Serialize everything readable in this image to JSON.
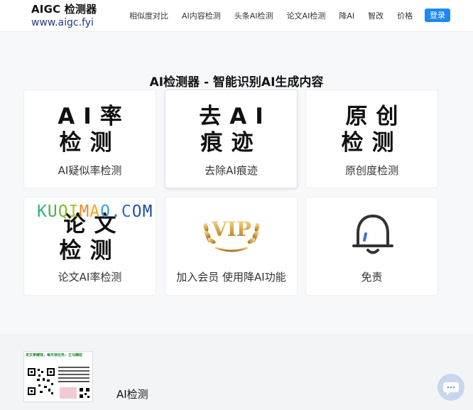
{
  "brand": {
    "title": "AIGC 检测器",
    "url": "www.aigc.fyi"
  },
  "nav": [
    "相似度对比",
    "AI内容检测",
    "头条AI检测",
    "论文AI检测",
    "降AI",
    "智改",
    "价格"
  ],
  "login_label": "登录",
  "page_title": "AI检测器 - 智能识别AI生成内容",
  "cards": [
    {
      "big": "AI率\n检测",
      "caption": "AI疑似率检测"
    },
    {
      "big": "去AI\n痕迹",
      "caption": "去除AI痕迹"
    },
    {
      "big": "原创\n检测",
      "caption": "原创度检测"
    },
    {
      "big": "论文\n检测",
      "caption": "论文AI率检测"
    },
    {
      "icon": "vip-badge-icon",
      "icon_text": "VIP",
      "caption": "加入会员 使用降AI功能"
    },
    {
      "icon": "bell-icon",
      "caption": "免责"
    }
  ],
  "watermark": "KUQIMAO.COM",
  "footer": {
    "qr_header": "发文章赚钱，每天领任务，立马赚取",
    "footer_label": "AI检测"
  },
  "colors": {
    "accent": "#1e88f5",
    "brand_url": "#1f3a8a",
    "bell_accent": "#3d6ee8"
  }
}
